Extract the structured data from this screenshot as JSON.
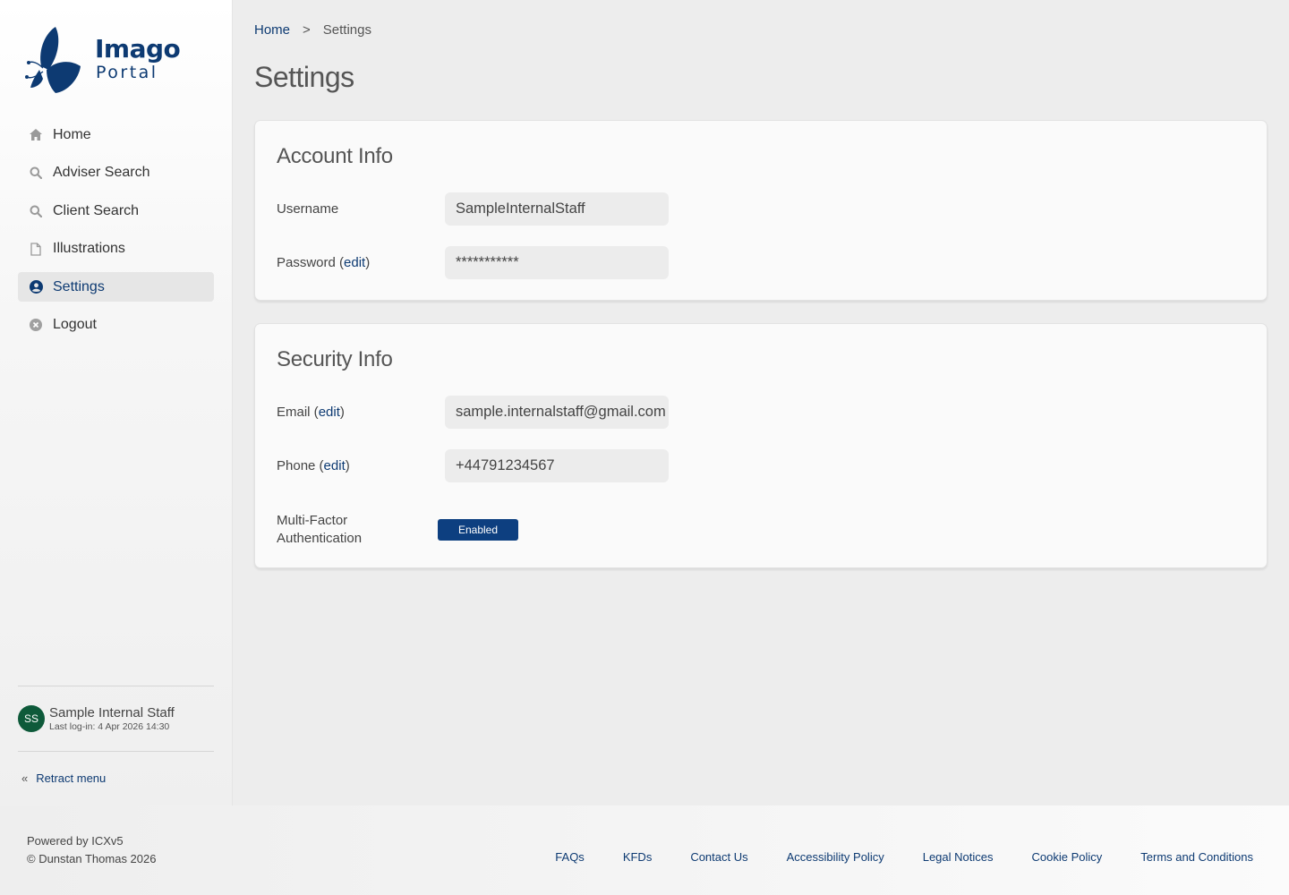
{
  "logo": {
    "line1": "Imago",
    "line2": "Portal",
    "brand_color": "#0d3a72"
  },
  "nav": {
    "items": [
      {
        "label": "Home",
        "icon": "home-icon",
        "active": false
      },
      {
        "label": "Adviser Search",
        "icon": "search-icon",
        "active": false
      },
      {
        "label": "Client Search",
        "icon": "search-icon",
        "active": false
      },
      {
        "label": "Illustrations",
        "icon": "document-icon",
        "active": false
      },
      {
        "label": "Settings",
        "icon": "user-circle-icon",
        "active": true
      },
      {
        "label": "Logout",
        "icon": "close-circle-icon",
        "active": false
      }
    ]
  },
  "user": {
    "initials": "SS",
    "name": "Sample Internal Staff",
    "last_login": "Last log-in: 4 Apr 2026 14:30",
    "avatar_color": "#0e5a3a"
  },
  "retract": {
    "label": "Retract menu",
    "icon": "double-chevron-left-icon"
  },
  "breadcrumb": {
    "home": "Home",
    "separator": ">",
    "current": "Settings"
  },
  "page_title": "Settings",
  "account": {
    "title": "Account Info",
    "username_label": "Username",
    "username_value": "SampleInternalStaff",
    "password_label": "Password",
    "password_value": "***********",
    "edit_label": "edit"
  },
  "security": {
    "title": "Security Info",
    "email_label": "Email",
    "email_value": "sample.internalstaff@gmail.com",
    "phone_label": "Phone",
    "phone_value": "+44791234567",
    "mfa_label_1": "Multi-Factor",
    "mfa_label_2": "Authentication",
    "mfa_status": "Enabled",
    "edit_label": "edit"
  },
  "footer": {
    "powered_by": "Powered by ICXv5",
    "copyright": "© Dunstan Thomas 2026",
    "links": [
      "FAQs",
      "KFDs",
      "Contact Us",
      "Accessibility Policy",
      "Legal Notices",
      "Cookie Policy",
      "Terms and Conditions"
    ]
  }
}
